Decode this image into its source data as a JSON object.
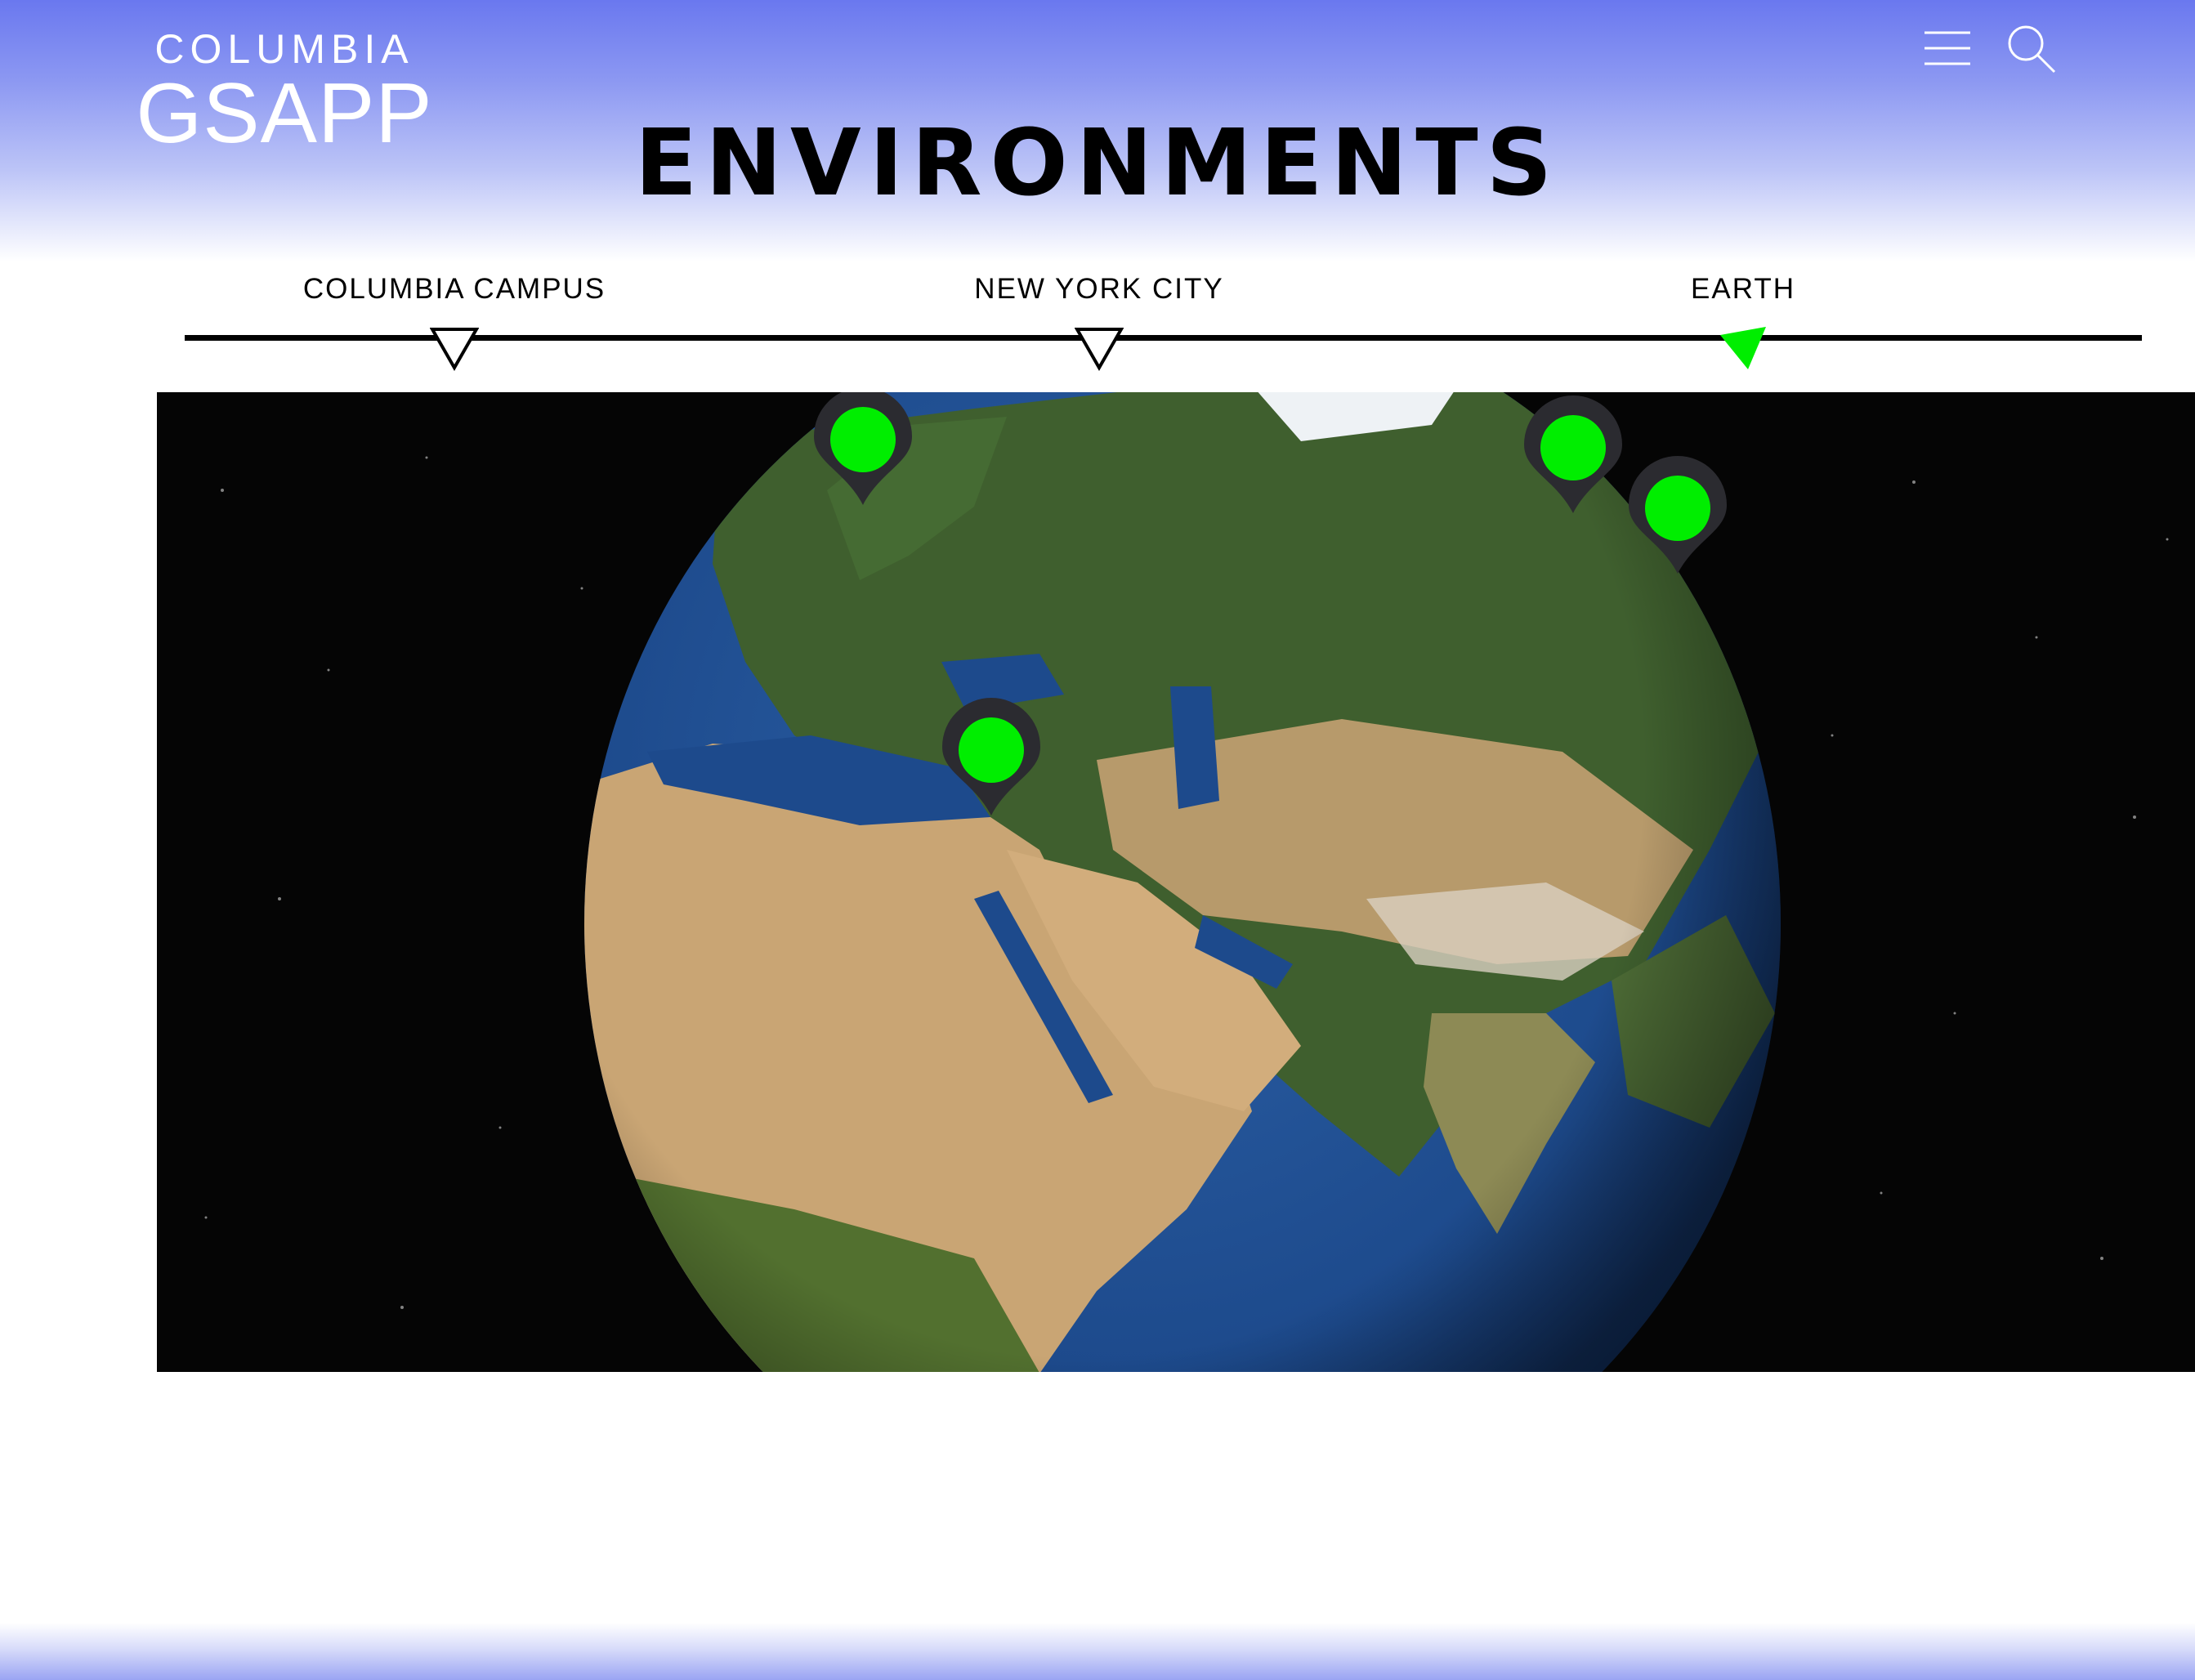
{
  "header": {
    "logo_top": "COLUMBIA",
    "logo_bottom": "GSAPP",
    "menu_icon": "hamburger-menu-icon",
    "search_icon": "search-icon"
  },
  "page": {
    "title": "ENVIRONMENTS"
  },
  "scale_nav": {
    "stops": [
      {
        "label": "COLUMBIA CAMPUS",
        "active": false
      },
      {
        "label": "NEW YORK CITY",
        "active": false
      },
      {
        "label": "EARTH",
        "active": true
      }
    ]
  },
  "map": {
    "view": "earth-globe",
    "pin_count": 4
  },
  "colors": {
    "header_gradient_top": "#6a78ef",
    "accent_green": "#00ee00",
    "pin_body": "#2b2b30",
    "space_background": "#050505",
    "ocean": "#1d4a8c",
    "desert": "#c9a574",
    "forest": "#3f5f2e"
  }
}
